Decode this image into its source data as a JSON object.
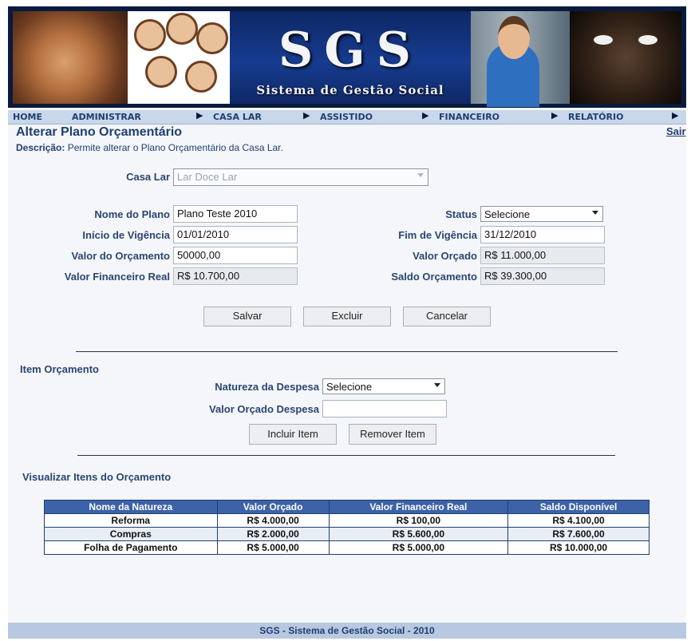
{
  "banner": {
    "logo": "SGS",
    "subtitle": "Sistema de Gestão Social"
  },
  "menu": {
    "items": [
      "HOME",
      "ADMINISTRAR",
      "CASA LAR",
      "ASSISTIDO",
      "FINANCEIRO",
      "RELATÓRIO"
    ],
    "arrow": "▶"
  },
  "header": {
    "title": "Alterar Plano Orçamentário",
    "logout": "Sair",
    "desc_label": "Descrição:",
    "desc_text": " Permite alterar o Plano Orçamentário da Casa Lar."
  },
  "form": {
    "casa_lar_label": "Casa Lar",
    "casa_lar_value": "Lar Doce Lar",
    "nome_label": "Nome do Plano",
    "nome_value": "Plano Teste 2010",
    "inicio_label": "Início de Vigência",
    "inicio_value": "01/01/2010",
    "valor_orc_label": "Valor do Orçamento",
    "valor_orc_value": "50000,00",
    "fin_real_label": "Valor Financeiro Real",
    "fin_real_value": "R$ 10.700,00",
    "status_label": "Status",
    "status_value": "Selecione",
    "fim_label": "Fim de Vigência",
    "fim_value": "31/12/2010",
    "valor_orcado_label": "Valor Orçado",
    "valor_orcado_value": "R$ 11.000,00",
    "saldo_label": "Saldo Orçamento",
    "saldo_value": "R$ 39.300,00",
    "btn_save": "Salvar",
    "btn_delete": "Excluir",
    "btn_cancel": "Cancelar"
  },
  "item": {
    "section_title": "Item Orçamento",
    "natureza_label": "Natureza da Despesa",
    "natureza_value": "Selecione",
    "valor_label": "Valor Orçado Despesa",
    "valor_value": "",
    "btn_add": "Incluir Item",
    "btn_remove": "Remover Item"
  },
  "table": {
    "section_title": "Visualizar Itens do Orçamento",
    "headers": [
      "Nome da Natureza",
      "Valor Orçado",
      "Valor Financeiro Real",
      "Saldo Disponível"
    ],
    "rows": [
      [
        "Reforma",
        "R$ 4.000,00",
        "R$ 100,00",
        "R$ 4.100,00"
      ],
      [
        "Compras",
        "R$ 2.000,00",
        "R$ 5.600,00",
        "R$ 7.600,00"
      ],
      [
        "Folha de Pagamento",
        "R$ 5.000,00",
        "R$ 5.000,00",
        "R$ 10.000,00"
      ]
    ]
  },
  "footer": {
    "text": "SGS - Sistema de Gestão Social - 2010"
  }
}
